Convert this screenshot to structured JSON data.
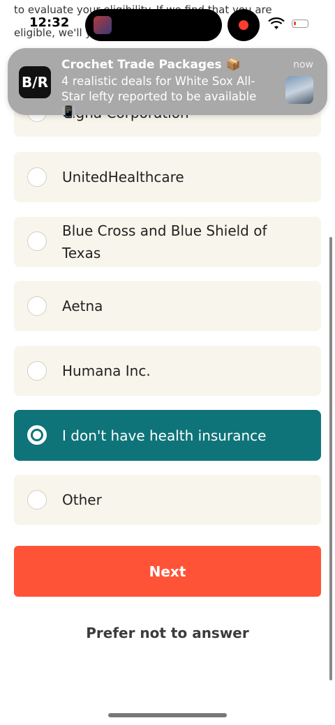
{
  "background": {
    "line1": "to evaluate your eligibility. If we find that you are",
    "line2": "eligible, we'll                                        you don't miss"
  },
  "status_bar": {
    "time": "12:32"
  },
  "notification": {
    "app_icon_text": "B/R",
    "title": "Crochet Trade Packages 📦",
    "body": "4 realistic deals for White Sox All-Star lefty reported to be available 📳",
    "time": "now"
  },
  "options": [
    {
      "label": "Cigna Corporation",
      "selected": false
    },
    {
      "label": "UnitedHealthcare",
      "selected": false
    },
    {
      "label": "Blue Cross and Blue Shield of Texas",
      "selected": false
    },
    {
      "label": "Aetna",
      "selected": false
    },
    {
      "label": "Humana Inc.",
      "selected": false
    },
    {
      "label": "I don't have health insurance",
      "selected": true
    },
    {
      "label": "Other",
      "selected": false
    }
  ],
  "next_button": "Next",
  "prefer_not": "Prefer not to answer",
  "colors": {
    "selected": "#0e7479",
    "next": "#ff5338",
    "option_bg": "#f8f5ec"
  }
}
